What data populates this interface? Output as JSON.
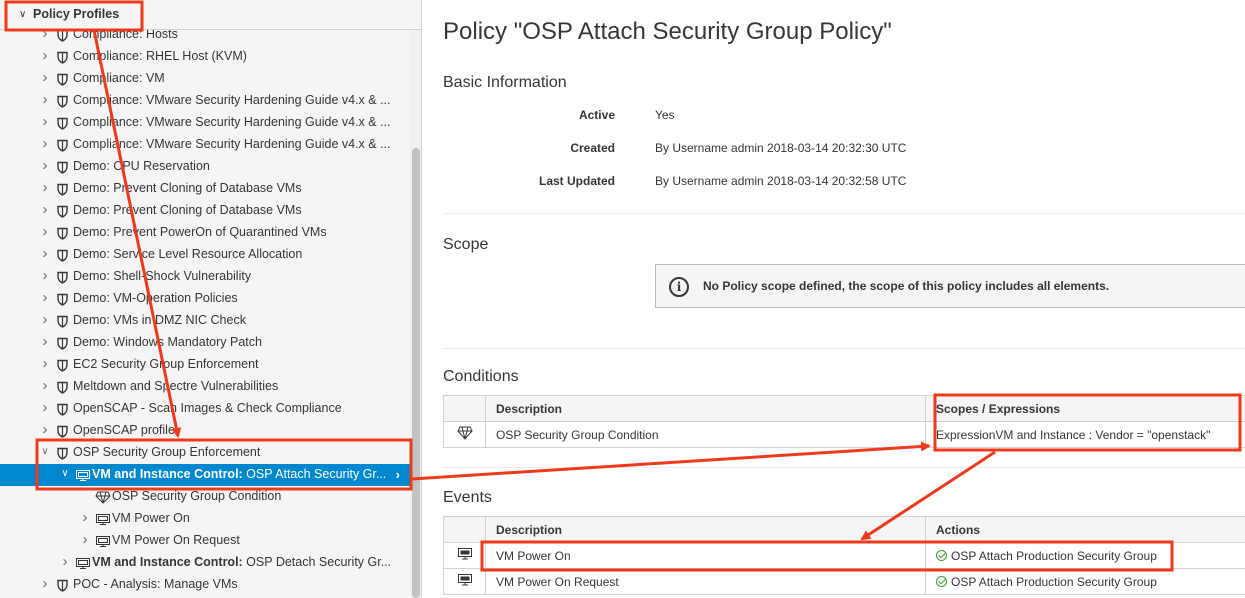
{
  "tree": {
    "header": "Policy Profiles",
    "rows": [
      {
        "indent": 0,
        "icon": "shield-icon",
        "label": "Compliance: Hosts"
      },
      {
        "indent": 0,
        "icon": "shield-icon",
        "label": "Compliance: RHEL Host (KVM)"
      },
      {
        "indent": 0,
        "icon": "shield-icon",
        "label": "Compliance: VM"
      },
      {
        "indent": 0,
        "icon": "shield-icon",
        "label": "Compliance: VMware Security Hardening Guide v4.x & ..."
      },
      {
        "indent": 0,
        "icon": "shield-icon",
        "label": "Compliance: VMware Security Hardening Guide v4.x & ..."
      },
      {
        "indent": 0,
        "icon": "shield-icon",
        "label": "Compliance: VMware Security Hardening Guide v4.x & ..."
      },
      {
        "indent": 0,
        "icon": "shield-icon",
        "label": "Demo: CPU Reservation"
      },
      {
        "indent": 0,
        "icon": "shield-icon",
        "label": "Demo: Prevent Cloning of Database VMs"
      },
      {
        "indent": 0,
        "icon": "shield-icon",
        "label": "Demo: Prevent Cloning of Database VMs"
      },
      {
        "indent": 0,
        "icon": "shield-icon",
        "label": "Demo: Prevent PowerOn of Quarantined VMs"
      },
      {
        "indent": 0,
        "icon": "shield-icon",
        "label": "Demo: Service Level Resource Allocation"
      },
      {
        "indent": 0,
        "icon": "shield-icon",
        "label": "Demo: Shell-Shock Vulnerability"
      },
      {
        "indent": 0,
        "icon": "shield-icon",
        "label": "Demo: VM-Operation Policies"
      },
      {
        "indent": 0,
        "icon": "shield-icon",
        "label": "Demo: VMs in DMZ NIC Check"
      },
      {
        "indent": 0,
        "icon": "shield-icon",
        "label": "Demo: Windows Mandatory Patch"
      },
      {
        "indent": 0,
        "icon": "shield-icon",
        "label": "EC2 Security Group Enforcement"
      },
      {
        "indent": 0,
        "icon": "shield-icon",
        "label": "Meltdown and Spectre Vulnerabilities"
      },
      {
        "indent": 0,
        "icon": "shield-icon",
        "label": "OpenSCAP - Scan Images & Check Compliance"
      },
      {
        "indent": 0,
        "icon": "shield-icon",
        "label": "OpenSCAP profile"
      },
      {
        "indent": 0,
        "icon": "shield-icon",
        "label": "OSP Security Group Enforcement",
        "expanded": true
      },
      {
        "indent": 1,
        "icon": "vm-icon",
        "bold": "VM and Instance Control:",
        "label": " OSP Attach Security Gr...",
        "expanded": true,
        "selected": true
      },
      {
        "indent": 2,
        "icon": "condition-icon",
        "label": "OSP Security Group Condition",
        "leaf": true
      },
      {
        "indent": 2,
        "icon": "vm-icon",
        "label": "VM Power On"
      },
      {
        "indent": 2,
        "icon": "vm-icon",
        "label": "VM Power On Request"
      },
      {
        "indent": 1,
        "icon": "vm-icon",
        "bold": "VM and Instance Control:",
        "label": " OSP Detach Security Gr..."
      },
      {
        "indent": 0,
        "icon": "shield-icon",
        "label": "POC - Analysis: Manage VMs"
      }
    ]
  },
  "main": {
    "title": "Policy \"OSP Attach Security Group Policy\"",
    "basic": {
      "heading": "Basic Information",
      "active_label": "Active",
      "active_value": "Yes",
      "created_label": "Created",
      "created_value": "By Username admin 2018-03-14 20:32:30 UTC",
      "updated_label": "Last Updated",
      "updated_value": "By Username admin 2018-03-14 20:32:58 UTC"
    },
    "scope": {
      "heading": "Scope",
      "message": "No Policy scope defined, the scope of this policy includes all elements."
    },
    "conditions": {
      "heading": "Conditions",
      "col_description": "Description",
      "col_scopes": "Scopes / Expressions",
      "row_description": "OSP Security Group Condition",
      "row_expression": "ExpressionVM and Instance : Vendor = \"openstack\""
    },
    "events": {
      "heading": "Events",
      "col_description": "Description",
      "col_actions": "Actions",
      "rows": [
        {
          "description": "VM Power On",
          "action": "OSP Attach Production Security Group"
        },
        {
          "description": "VM Power On Request",
          "action": "OSP Attach Production Security Group"
        }
      ]
    }
  },
  "colors": {
    "selected": "#0088ce",
    "callout": "#ee3a1c",
    "ok": "#3f9c35"
  }
}
